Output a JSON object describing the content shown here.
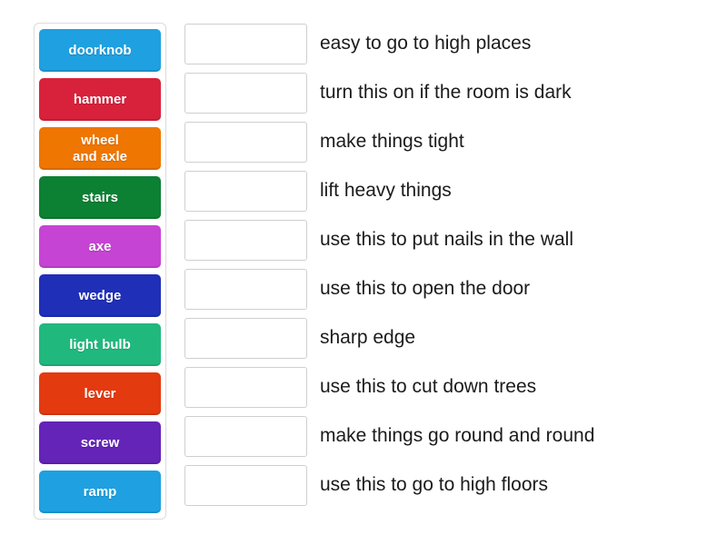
{
  "activity": {
    "type": "match-up",
    "tiles_panel_label": "Draggable answer tiles",
    "colors": {
      "doorknob": "#1fa0e0",
      "hammer": "#d8223c",
      "wheel_and_axle": "#ef7600",
      "stairs": "#0c8033",
      "axe": "#c644d4",
      "wedge": "#1f2fb8",
      "light_bulb": "#21b87e",
      "lever": "#e33a10",
      "screw": "#6424b8",
      "ramp": "#1fa0e0",
      "dropbox_border": "#cfcfcf",
      "panel_border": "#dcdcdc",
      "tile_text": "#ffffff",
      "definition_text": "#1b1b1b"
    },
    "tiles": [
      {
        "label": "doorknob",
        "color": "#1fa0e0"
      },
      {
        "label": "hammer",
        "color": "#d8223c"
      },
      {
        "label": "wheel\nand axle",
        "color": "#ef7600"
      },
      {
        "label": "stairs",
        "color": "#0c8033"
      },
      {
        "label": "axe",
        "color": "#c644d4"
      },
      {
        "label": "wedge",
        "color": "#1f2fb8"
      },
      {
        "label": "light bulb",
        "color": "#21b87e"
      },
      {
        "label": "lever",
        "color": "#e33a10"
      },
      {
        "label": "screw",
        "color": "#6424b8"
      },
      {
        "label": "ramp",
        "color": "#1fa0e0"
      }
    ],
    "rows": [
      {
        "dropbox_value": "",
        "definition": "easy to go to high places"
      },
      {
        "dropbox_value": "",
        "definition": "turn this on if the room is dark"
      },
      {
        "dropbox_value": "",
        "definition": "make things tight"
      },
      {
        "dropbox_value": "",
        "definition": "lift heavy things"
      },
      {
        "dropbox_value": "",
        "definition": "use this to put nails in the wall"
      },
      {
        "dropbox_value": "",
        "definition": "use this to open the door"
      },
      {
        "dropbox_value": "",
        "definition": "sharp edge"
      },
      {
        "dropbox_value": "",
        "definition": "use this to cut down trees"
      },
      {
        "dropbox_value": "",
        "definition": "make things go round and round"
      },
      {
        "dropbox_value": "",
        "definition": "use this to go to high floors"
      }
    ]
  }
}
